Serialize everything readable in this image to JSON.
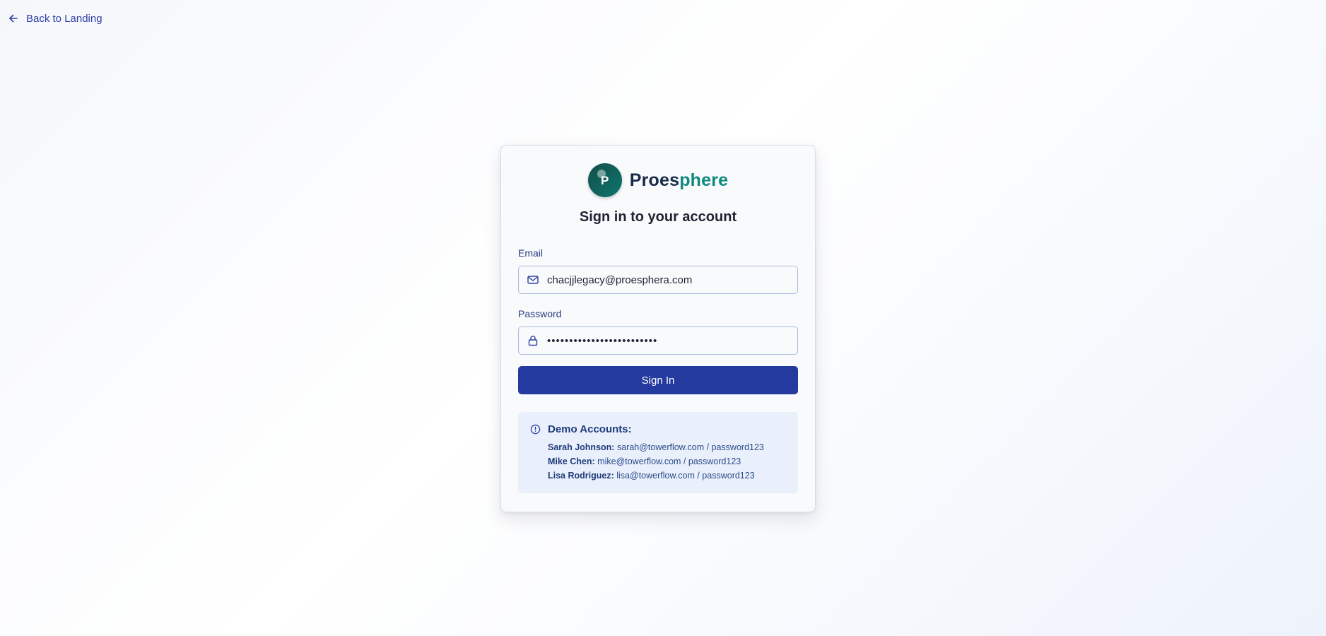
{
  "nav": {
    "back_label": "Back to Landing"
  },
  "brand": {
    "logo_letter": "P",
    "name_part1": "Proes",
    "name_part2": "phere"
  },
  "form": {
    "heading": "Sign in to your account",
    "email_label": "Email",
    "email_value": "chacjjlegacy@proesphera.com",
    "password_label": "Password",
    "password_value": "password123password123abc",
    "submit_label": "Sign In"
  },
  "demo": {
    "title": "Demo Accounts:",
    "accounts": [
      {
        "name": "Sarah Johnson:",
        "credentials": "sarah@towerflow.com / password123"
      },
      {
        "name": "Mike Chen:",
        "credentials": "mike@towerflow.com / password123"
      },
      {
        "name": "Lisa Rodriguez:",
        "credentials": "lisa@towerflow.com / password123"
      }
    ]
  },
  "colors": {
    "primary": "#253a9f",
    "brand_dark": "#1a2b4a",
    "brand_teal": "#0f8a7e",
    "info_bg": "#e9f0fb"
  },
  "icons": {
    "back": "arrow-left-icon",
    "email": "mail-icon",
    "password": "lock-icon",
    "info": "info-circle-icon"
  }
}
